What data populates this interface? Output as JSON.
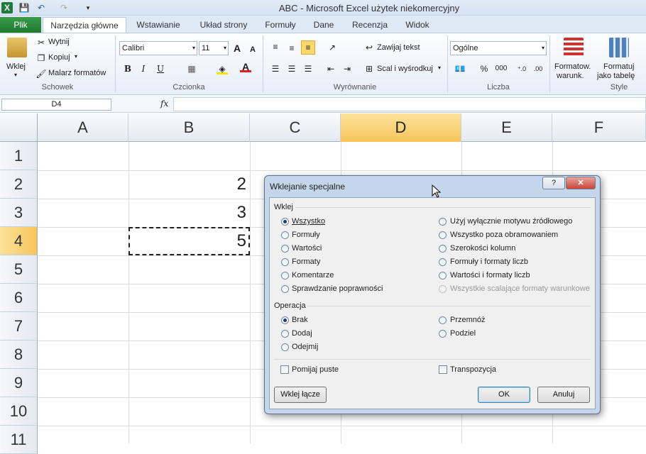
{
  "window": {
    "title": "ABC  -  Microsoft Excel użytek niekomercyjny"
  },
  "tabs": [
    "Plik",
    "Narzędzia główne",
    "Wstawianie",
    "Układ strony",
    "Formuły",
    "Dane",
    "Recenzja",
    "Widok"
  ],
  "ribbon": {
    "clipboard": {
      "paste": "Wklej",
      "cut": "Wytnij",
      "copy": "Kopiuj",
      "painter": "Malarz formatów",
      "label": "Schowek"
    },
    "font": {
      "name": "Calibri",
      "size": "11",
      "bold": "B",
      "italic": "I",
      "underline": "U",
      "label": "Czcionka"
    },
    "alignment": {
      "wrap": "Zawijaj tekst",
      "merge": "Scal i wyśrodkuj",
      "label": "Wyrównanie"
    },
    "number": {
      "format": "Ogólne",
      "percent": "%",
      "thousands": "000",
      "label": "Liczba"
    },
    "styles": {
      "cond": "Formatow.",
      "cond2": "warunk.",
      "table": "Formatuj",
      "table2": "jako tabelę",
      "label": "Style"
    }
  },
  "formula_bar": {
    "name_box": "D4",
    "fx": "fx",
    "value": ""
  },
  "columns": [
    "A",
    "B",
    "C",
    "D",
    "E",
    "F"
  ],
  "rows": [
    "1",
    "2",
    "3",
    "4",
    "5",
    "6",
    "7",
    "8",
    "9",
    "10",
    "11"
  ],
  "cells": {
    "B2": "2",
    "B3": "3",
    "B4": "5"
  },
  "dialog": {
    "title": "Wklejanie specjalne",
    "help": "?",
    "close": "✕",
    "paste_section": "Wklej",
    "paste_left": [
      "Wszystko",
      "Formuły",
      "Wartości",
      "Formaty",
      "Komentarze",
      "Sprawdzanie poprawności"
    ],
    "paste_right": [
      "Użyj wyłącznie motywu źródłowego",
      "Wszystko poza obramowaniem",
      "Szerokości kolumn",
      "Formuły i formaty liczb",
      "Wartości i formaty liczb",
      "Wszystkie scalające formaty warunkowe"
    ],
    "operation_section": "Operacja",
    "op_left": [
      "Brak",
      "Dodaj",
      "Odejmij"
    ],
    "op_right": [
      "Przemnóż",
      "Podziel"
    ],
    "skip_blanks": "Pomijaj puste",
    "transpose": "Transpozycja",
    "paste_link": "Wklej łącze",
    "ok": "OK",
    "cancel": "Anuluj"
  },
  "colors": {
    "accent": "#f7c55a",
    "file_tab": "#2a8a3a",
    "dialog_frame": "#c5d6ea"
  }
}
